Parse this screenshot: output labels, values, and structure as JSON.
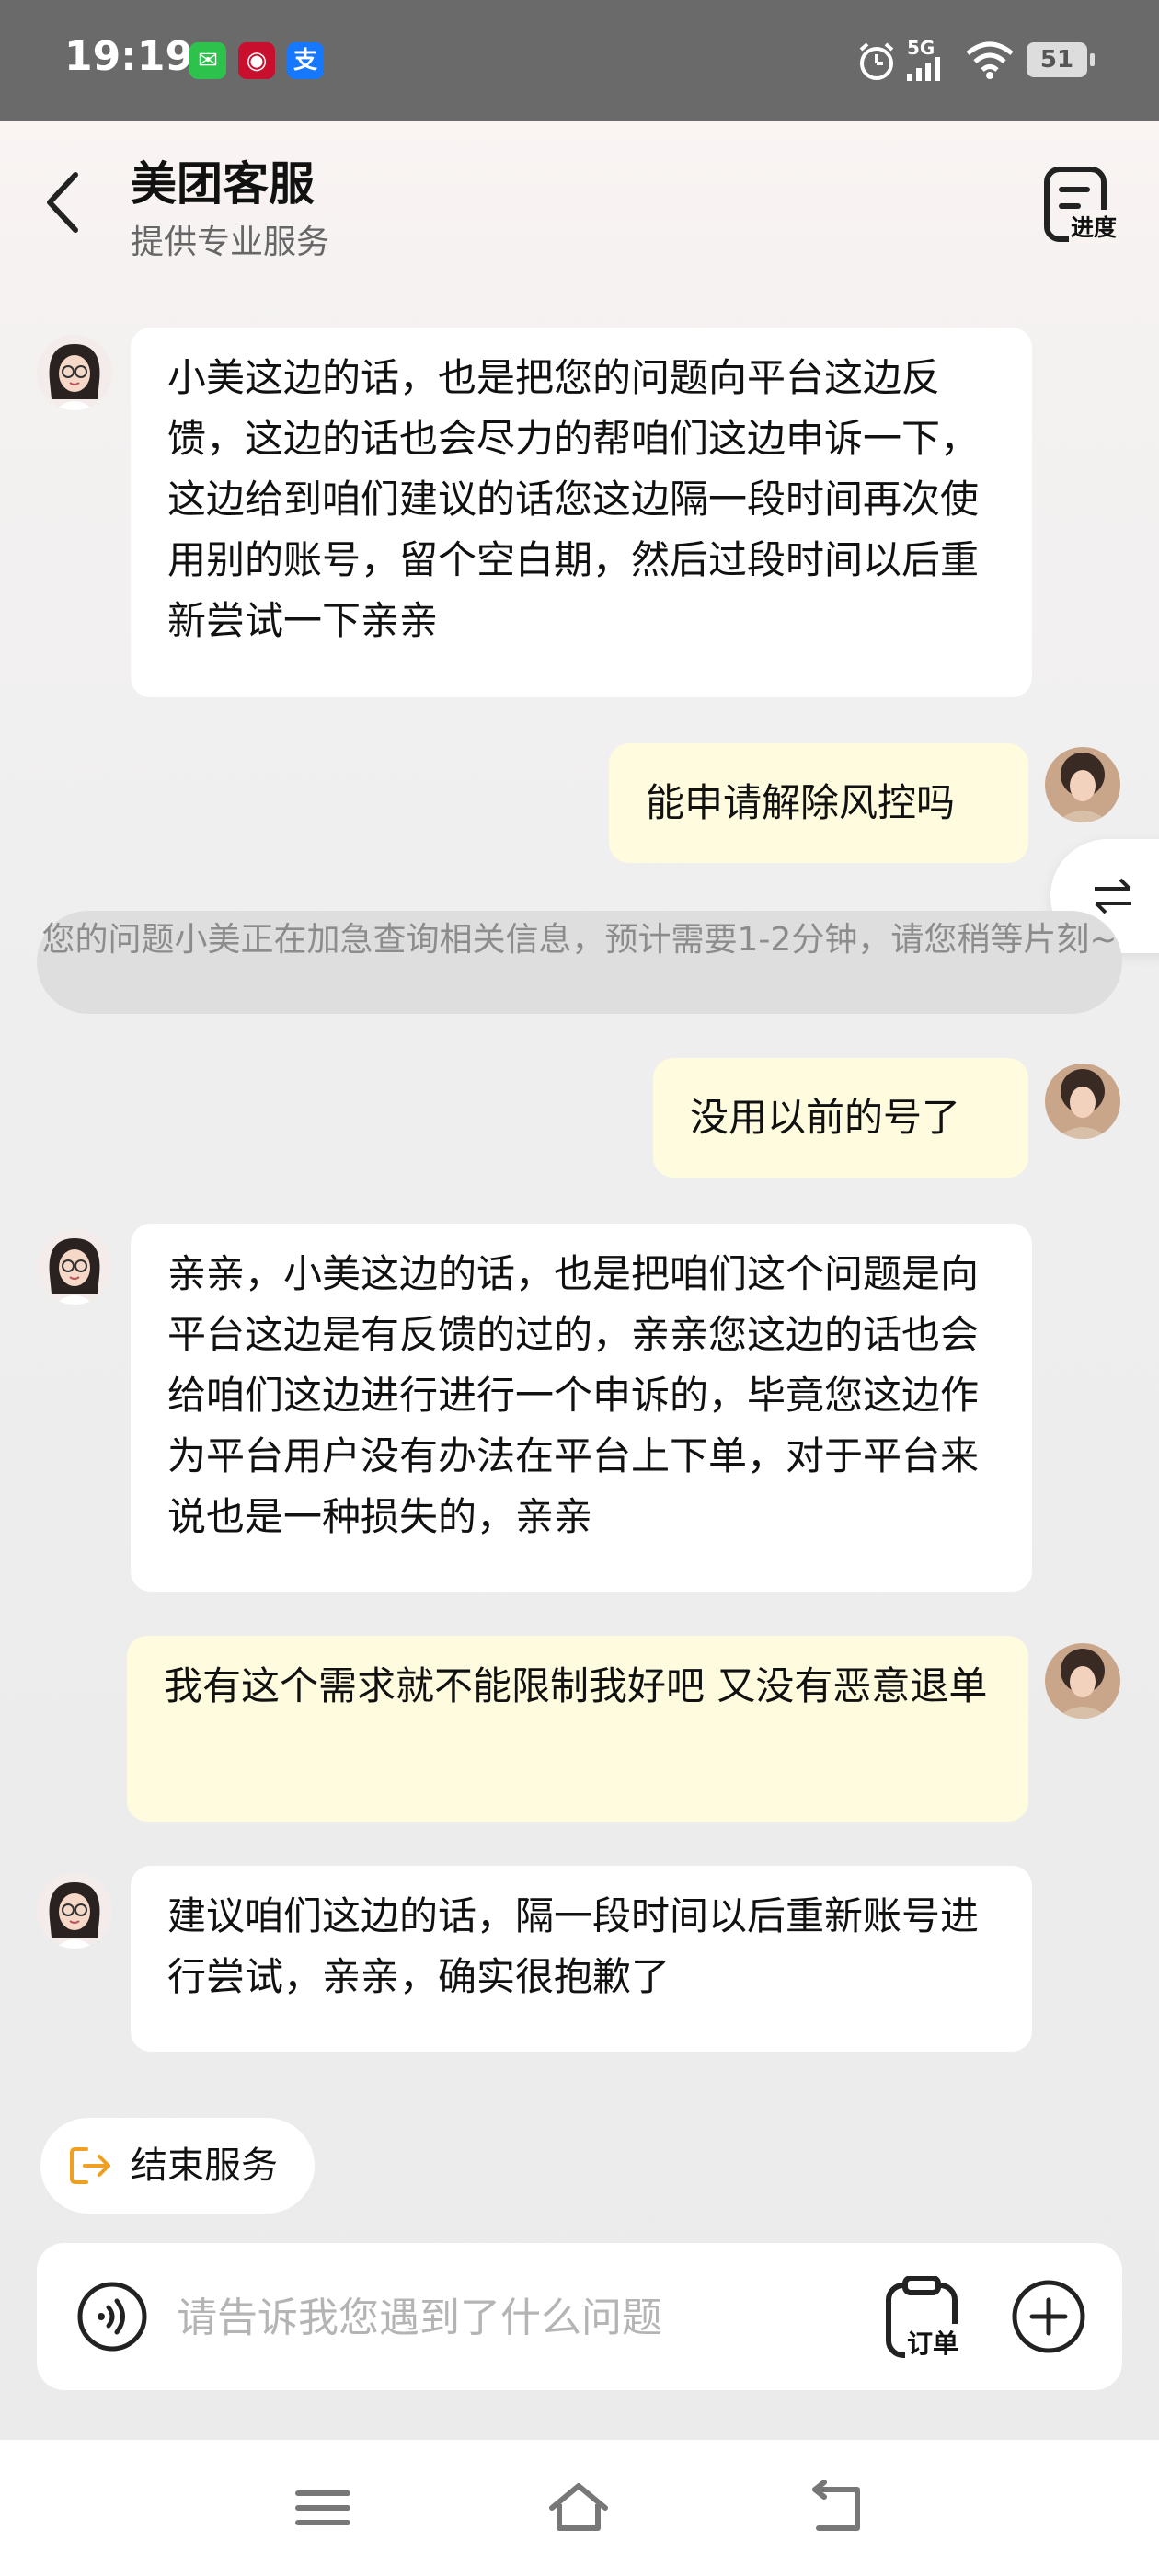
{
  "status_bar": {
    "time": "19:19",
    "apps": [
      {
        "icon": "wechat-icon",
        "color": "#2dc24c"
      },
      {
        "icon": "bank-of-china-icon",
        "color": "#c8102e"
      },
      {
        "icon": "alipay-icon",
        "color": "#1677ff"
      }
    ],
    "network": "5G",
    "battery": "51"
  },
  "header": {
    "title": "美团客服",
    "subtitle": "提供专业服务",
    "progress_label": "进度"
  },
  "messages": [
    {
      "side": "left",
      "text": "小美这边的话，也是把您的问题向平台这边反馈，这边的话也会尽力的帮咱们这边申诉一下，这边给到咱们建议的话您这边隔一段时间再次使用别的账号，留个空白期，然后过段时间以后重新尝试一下亲亲"
    },
    {
      "side": "right",
      "text": "能申请解除风控吗"
    },
    {
      "side": "right",
      "text": "没用以前的号了"
    },
    {
      "side": "left",
      "text": "亲亲，小美这边的话，也是把咱们这个问题是向平台这边是有反馈的过的，亲亲您这边的话也会给咱们这边进行进行一个申诉的，毕竟您这边作为平台用户没有办法在平台上下单，对于平台来说也是一种损失的，亲亲"
    },
    {
      "side": "right",
      "text": "我有这个需求就不能限制我好吧 又没有恶意退单"
    },
    {
      "side": "left",
      "text": "建议咱们这边的话，隔一段时间以后重新账号进行尝试，亲亲，确实很抱歉了"
    }
  ],
  "system_note": "您的问题小美正在加急查询相关信息，预计需要1-2分钟，请您稍等片刻~",
  "end_service_label": "结束服务",
  "input": {
    "placeholder": "请告诉我您遇到了什么问题",
    "value": "",
    "order_label": "订单"
  },
  "colors": {
    "bubble_right": "#fefbdf",
    "bubble_left": "#ffffff",
    "accent": "#f0a020"
  }
}
